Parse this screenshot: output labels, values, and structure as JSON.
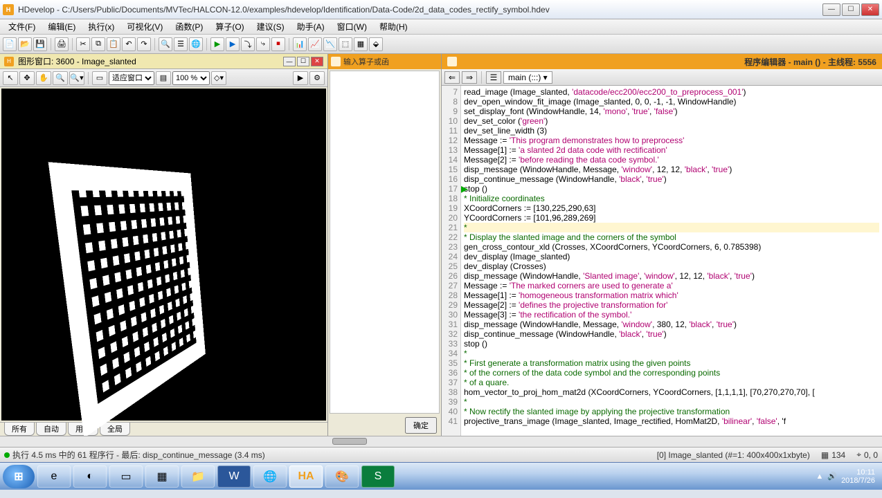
{
  "title": "HDevelop - C:/Users/Public/Documents/MVTec/HALCON-12.0/examples/hdevelop/Identification/Data-Code/2d_data_codes_rectify_symbol.hdev",
  "menus": [
    "文件(F)",
    "编辑(E)",
    "执行(x)",
    "可视化(V)",
    "函数(P)",
    "算子(O)",
    "建议(S)",
    "助手(A)",
    "窗口(W)",
    "帮助(H)"
  ],
  "graphic_window": {
    "label": "图形窗口: 3600 - Image_slanted",
    "fit": "适应窗口",
    "zoom": "100 %"
  },
  "tabs": [
    "所有",
    "自动",
    "用户",
    "全局"
  ],
  "mid": {
    "label": "输入算子或函",
    "ok": "确定"
  },
  "editor": {
    "title": "程序编辑器 - main () - 主线程: 5556",
    "combo": "main (:::)"
  },
  "code_start": 7,
  "code": [
    {
      "t": "read_image (Image_slanted, 'datacode/ecc200/ecc200_to_preprocess_001')",
      "c": "k"
    },
    {
      "t": "dev_open_window_fit_image (Image_slanted, 0, 0, -1, -1, WindowHandle)",
      "c": "k"
    },
    {
      "t": "set_display_font (WindowHandle, 14, 'mono', 'true', 'false')",
      "c": "k"
    },
    {
      "t": "dev_set_color ('green')",
      "c": "k"
    },
    {
      "t": "dev_set_line_width (3)",
      "c": "k"
    },
    {
      "t": "Message := 'This program demonstrates how to preprocess'",
      "c": "k"
    },
    {
      "t": "Message[1] := 'a slanted 2d data code with rectification'",
      "c": "k"
    },
    {
      "t": "Message[2] := 'before reading the data code symbol.'",
      "c": "k"
    },
    {
      "t": "disp_message (WindowHandle, Message, 'window', 12, 12, 'black', 'true')",
      "c": "k"
    },
    {
      "t": "disp_continue_message (WindowHandle, 'black', 'true')",
      "c": "k"
    },
    {
      "t": "stop ()",
      "c": "k",
      "pc": true
    },
    {
      "t": "* Initialize coordinates",
      "c": "c"
    },
    {
      "t": "XCoordCorners := [130,225,290,63]",
      "c": "k"
    },
    {
      "t": "YCoordCorners := [101,96,289,269]",
      "c": "k"
    },
    {
      "t": "*",
      "c": "c",
      "hl": true
    },
    {
      "t": "* Display the slanted image and the corners of the symbol",
      "c": "c"
    },
    {
      "t": "gen_cross_contour_xld (Crosses, XCoordCorners, YCoordCorners, 6, 0.785398)",
      "c": "k"
    },
    {
      "t": "dev_display (Image_slanted)",
      "c": "k"
    },
    {
      "t": "dev_display (Crosses)",
      "c": "k"
    },
    {
      "t": "disp_message (WindowHandle, 'Slanted image', 'window', 12, 12, 'black', 'true')",
      "c": "k"
    },
    {
      "t": "Message := 'The marked corners are used to generate a'",
      "c": "k"
    },
    {
      "t": "Message[1] := 'homogeneous transformation matrix which'",
      "c": "k"
    },
    {
      "t": "Message[2] := 'defines the projective transformation for'",
      "c": "k"
    },
    {
      "t": "Message[3] := 'the rectification of the symbol.'",
      "c": "k"
    },
    {
      "t": "disp_message (WindowHandle, Message, 'window', 380, 12, 'black', 'true')",
      "c": "k"
    },
    {
      "t": "disp_continue_message (WindowHandle, 'black', 'true')",
      "c": "k"
    },
    {
      "t": "stop ()",
      "c": "k"
    },
    {
      "t": "*",
      "c": "c"
    },
    {
      "t": "* First generate a transformation matrix using the given points",
      "c": "c"
    },
    {
      "t": "* of the corners of the data code symbol and the corresponding points",
      "c": "c"
    },
    {
      "t": "* of a quare.",
      "c": "c"
    },
    {
      "t": "hom_vector_to_proj_hom_mat2d (XCoordCorners, YCoordCorners, [1,1,1,1], [70,270,270,70], [",
      "c": "k"
    },
    {
      "t": "*",
      "c": "c"
    },
    {
      "t": "* Now rectify the slanted image by applying the projective transformation",
      "c": "c"
    },
    {
      "t": "projective_trans_image (Image_slanted, Image_rectified, HomMat2D, 'bilinear', 'false', 'f",
      "c": "k"
    }
  ],
  "status": {
    "left": "执行 4.5 ms 中的 61 程序行 - 最后: disp_continue_message (3.4 ms)",
    "img": "[0] Image_slanted (#=1: 400x400x1xbyte)",
    "num": "134",
    "coord": "0, 0"
  },
  "clock": {
    "time": "10:11",
    "date": "2018/7/26"
  }
}
